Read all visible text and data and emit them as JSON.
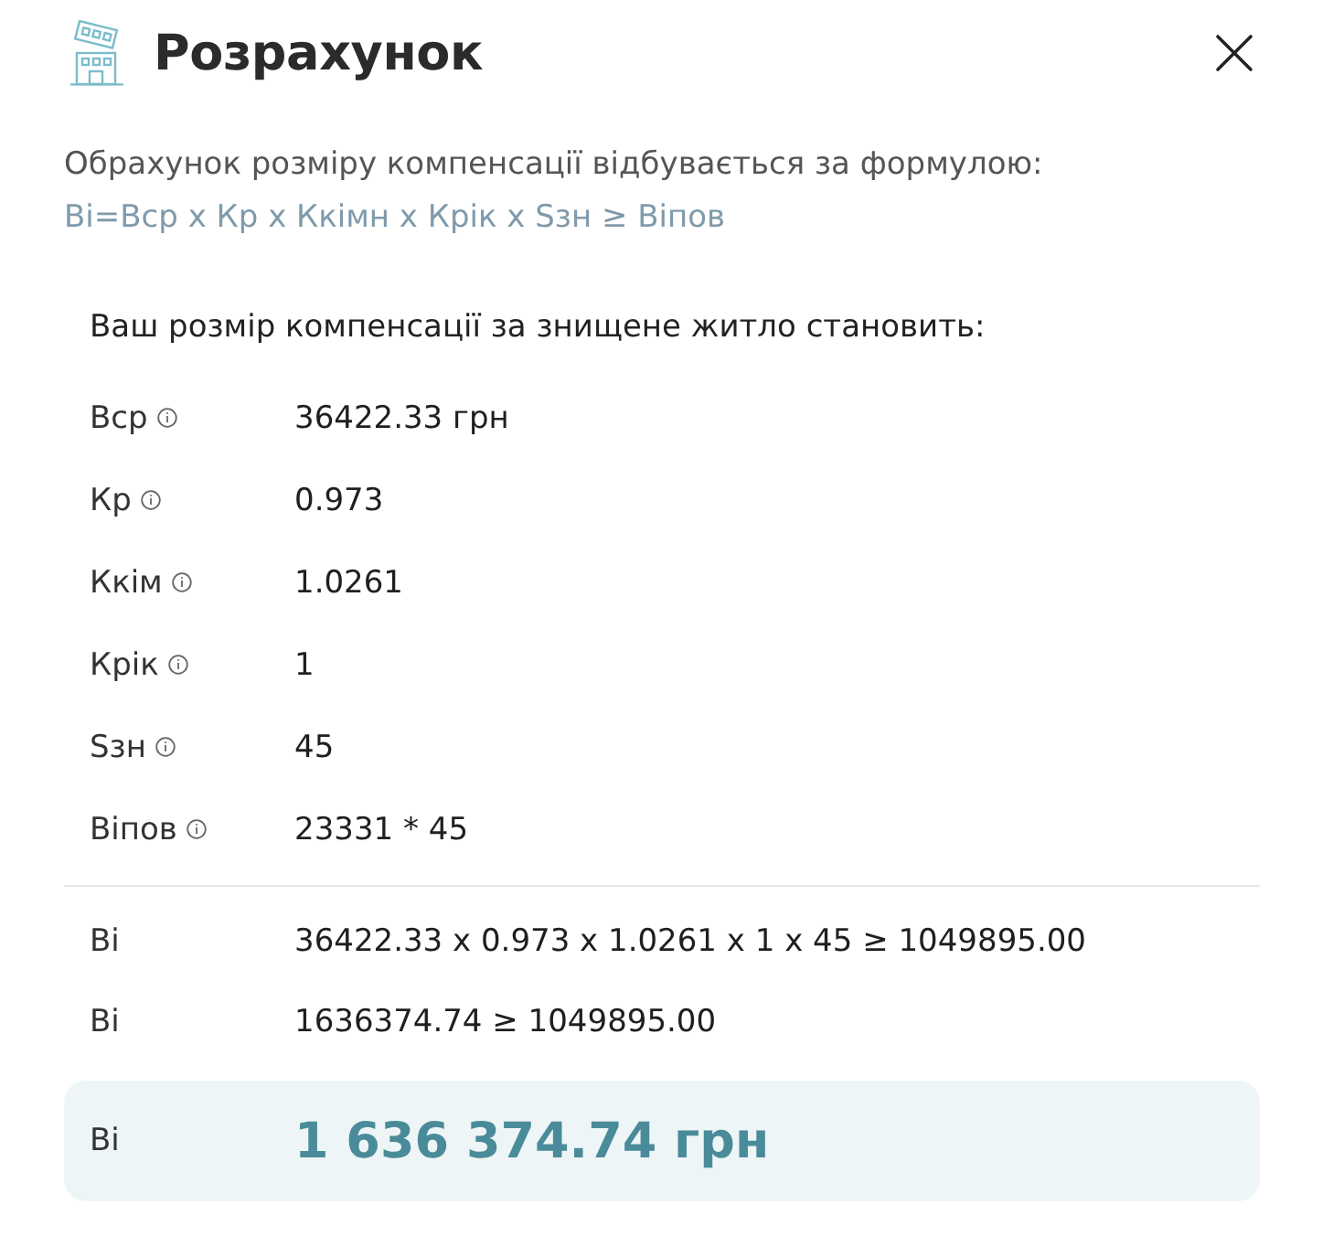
{
  "dialog": {
    "title": "Розрахунок",
    "description": "Обрахунок розміру компенсації відбувається за формулою:",
    "formula": "Ві=Вср x Кр x Ккімн x Крік x Sзн ≥ Віпов"
  },
  "summary": {
    "heading": "Ваш розмір компенсації за знищене житло становить:",
    "parameters": [
      {
        "label": "Вср",
        "value": "36422.33 грн"
      },
      {
        "label": "Кр",
        "value": "0.973"
      },
      {
        "label": "Ккім",
        "value": "1.0261"
      },
      {
        "label": "Крік",
        "value": "1"
      },
      {
        "label": "Sзн",
        "value": "45"
      },
      {
        "label": "Віпов",
        "value": "23331 * 45"
      }
    ],
    "calculations": [
      {
        "label": "Ві",
        "value": "36422.33 x 0.973 x 1.0261 x 1 x 45 ≥ 1049895.00"
      },
      {
        "label": "Ві",
        "value": "1636374.74 ≥ 1049895.00"
      }
    ],
    "result": {
      "label": "Ві",
      "value": "1 636 374.74 грн"
    }
  }
}
